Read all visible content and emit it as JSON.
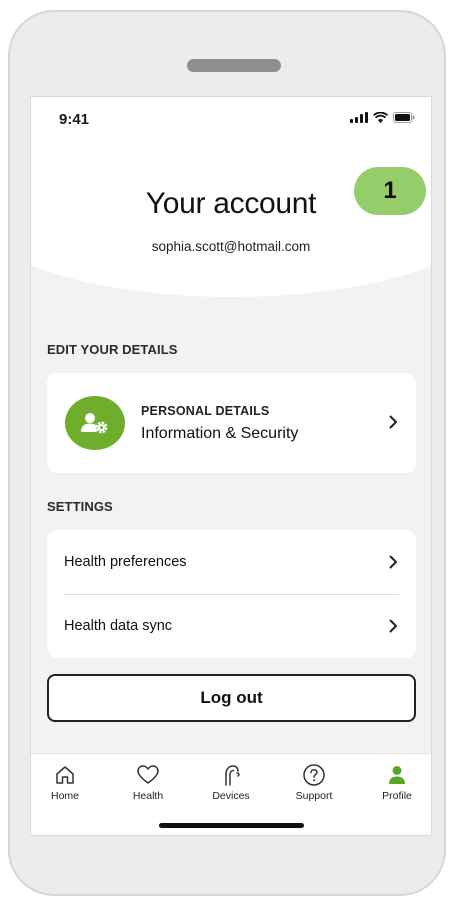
{
  "status_bar": {
    "time": "9:41"
  },
  "header": {
    "badge": "1",
    "title": "Your account",
    "email": "sophia.scott@hotmail.com"
  },
  "edit_section": {
    "label": "EDIT YOUR DETAILS",
    "personal_details": {
      "title": "PERSONAL DETAILS",
      "subtitle": "Information & Security",
      "icon": "user-gear-icon"
    }
  },
  "settings_section": {
    "label": "SETTINGS",
    "items": [
      {
        "label": "Health preferences"
      },
      {
        "label": "Health data sync"
      }
    ]
  },
  "logout_label": "Log out",
  "tabs": [
    {
      "label": "Home",
      "icon": "home-icon"
    },
    {
      "label": "Health",
      "icon": "heart-icon"
    },
    {
      "label": "Devices",
      "icon": "hearing-aid-icon"
    },
    {
      "label": "Support",
      "icon": "help-icon"
    },
    {
      "label": "Profile",
      "icon": "profile-icon",
      "active": true
    }
  ],
  "colors": {
    "badge": "#96cd6b",
    "accent": "#6fae2d",
    "background": "#f2f2f2"
  }
}
